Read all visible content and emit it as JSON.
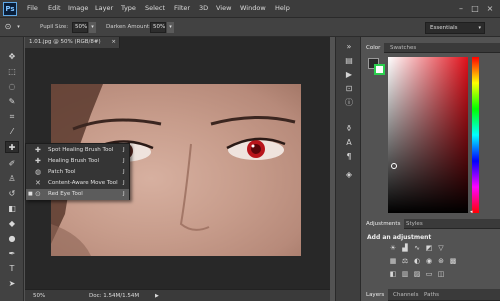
{
  "app": {
    "logo": "Ps"
  },
  "menu": [
    "File",
    "Edit",
    "Image",
    "Layer",
    "Type",
    "Select",
    "Filter",
    "3D",
    "View",
    "Window",
    "Help"
  ],
  "options": {
    "pupil_size_label": "Pupil Size:",
    "pupil_size_value": "50%",
    "darken_label": "Darken Amount:",
    "darken_value": "50%",
    "workspace": "Essentials"
  },
  "document": {
    "tab_title": "1.01.jpg @ 50% (RGB/8#)",
    "zoom": "50%",
    "doc_size": "Doc: 1.54M/1.54M"
  },
  "flyout": [
    {
      "label": "Spot Healing Brush Tool",
      "key": "J",
      "icon": "spot-healing-brush-icon",
      "selected": false
    },
    {
      "label": "Healing Brush Tool",
      "key": "J",
      "icon": "healing-brush-icon",
      "selected": false
    },
    {
      "label": "Patch Tool",
      "key": "J",
      "icon": "patch-icon",
      "selected": false
    },
    {
      "label": "Content-Aware Move Tool",
      "key": "J",
      "icon": "content-aware-move-icon",
      "selected": false
    },
    {
      "label": "Red Eye Tool",
      "key": "J",
      "icon": "red-eye-icon",
      "selected": true
    }
  ],
  "panels": {
    "color_tabs": [
      "Color",
      "Swatches"
    ],
    "adjust_tabs": [
      "Adjustments",
      "Styles"
    ],
    "adjust_title": "Add an adjustment",
    "layers_tabs": [
      "Layers",
      "Channels",
      "Paths"
    ]
  },
  "colors": {
    "foreground": "#2a2a2a",
    "background": "#ffffff",
    "pure_hue": "#e0101a"
  }
}
